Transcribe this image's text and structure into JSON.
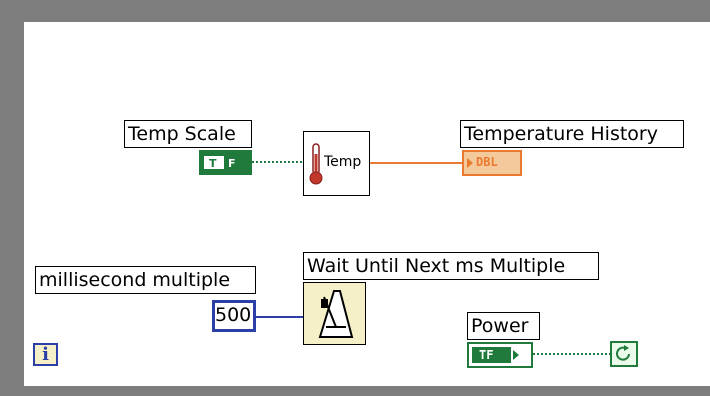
{
  "labels": {
    "temp_scale": "Temp Scale",
    "temperature_history": "Temperature History",
    "millisecond_multiple": "millisecond multiple",
    "wait_until_next": "Wait Until Next ms Multiple",
    "power": "Power"
  },
  "nodes": {
    "temp_subvi_text": "Temp",
    "dbl_text": "DBL",
    "constant_value": "500",
    "bool_text": "TF",
    "iteration_text": "i"
  },
  "colors": {
    "loop_frame": "#7d7d7d",
    "boolean_wire": "#1f7a3b",
    "numeric_dbl_wire": "#e97a2f",
    "integer_wire": "#2b3fa6"
  },
  "icons": [
    "thermometer-icon",
    "metronome-icon",
    "stop-condition-icon",
    "iteration-terminal-icon"
  ]
}
